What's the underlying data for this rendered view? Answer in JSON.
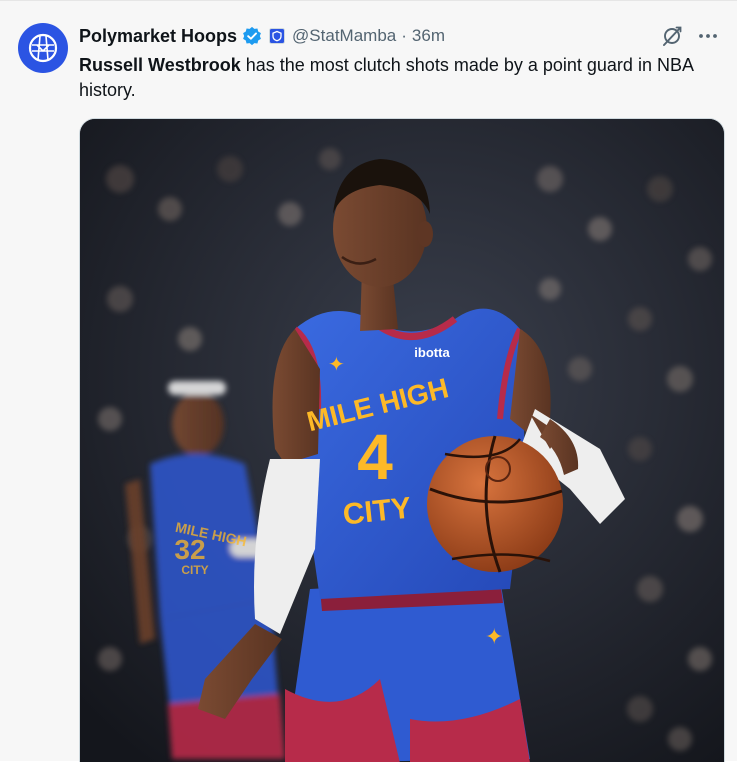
{
  "author": {
    "name": "Polymarket Hoops",
    "handle": "@StatMamba",
    "separator": "·",
    "time": "36m"
  },
  "tweet": {
    "bold": "Russell Westbrook",
    "text": " has the most clutch shots made by a point guard in NBA history."
  },
  "jersey": {
    "sponsor": "ibotta",
    "line1": "MILE HIGH",
    "number": "4",
    "line2": "CITY",
    "teammate_line1": "MILE HIGH",
    "teammate_number": "32",
    "teammate_line2": "CITY"
  },
  "icons": {
    "avatar": "polymarket-logo-icon",
    "verified": "verified-badge-icon",
    "affiliate": "affiliate-badge-icon",
    "grok": "grok-icon",
    "more": "more-icon"
  },
  "colors": {
    "accent": "#1d9bf0",
    "avatar": "#2b54e3",
    "jersey": "#2f5bd1",
    "trim": "#b72b4a",
    "lettering": "#fdb927"
  }
}
